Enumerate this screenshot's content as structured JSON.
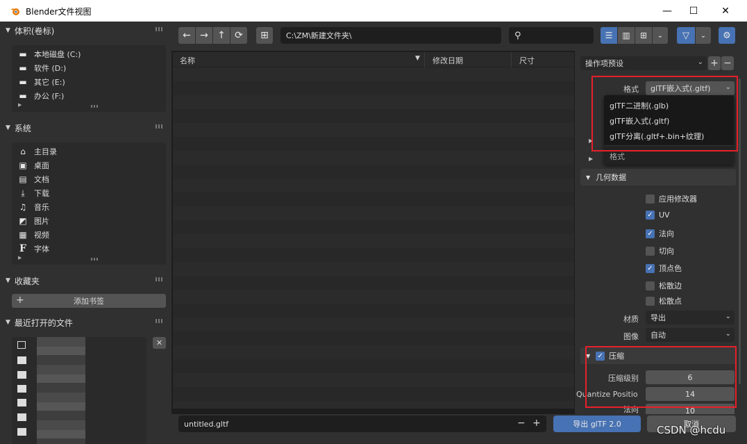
{
  "window": {
    "title": "Blender文件视图"
  },
  "sidebar": {
    "volumes": {
      "title": "体积(卷标)",
      "items": [
        {
          "label": "本地磁盘 (C:)",
          "icon": "disk-icon"
        },
        {
          "label": "软件 (D:)",
          "icon": "disk-icon"
        },
        {
          "label": "其它 (E:)",
          "icon": "disk-icon"
        },
        {
          "label": "办公 (F:)",
          "icon": "disk-icon"
        }
      ]
    },
    "system": {
      "title": "系统",
      "items": [
        {
          "label": "主目录",
          "icon": "home-icon"
        },
        {
          "label": "桌面",
          "icon": "desktop-icon"
        },
        {
          "label": "文档",
          "icon": "document-icon"
        },
        {
          "label": "下载",
          "icon": "download-icon"
        },
        {
          "label": "音乐",
          "icon": "music-icon"
        },
        {
          "label": "图片",
          "icon": "image-icon"
        },
        {
          "label": "视频",
          "icon": "film-icon"
        },
        {
          "label": "字体",
          "icon": "font-icon"
        }
      ]
    },
    "bookmarks": {
      "title": "收藏夹",
      "add_label": "添加书签"
    },
    "recent": {
      "title": "最近打开的文件"
    }
  },
  "topbar": {
    "path": "C:\\ZM\\新建文件夹\\",
    "search_value": ""
  },
  "list": {
    "col_name": "名称",
    "col_date": "修改日期",
    "col_size": "尺寸"
  },
  "right": {
    "preset_label": "操作项预设",
    "format_label": "格式",
    "format_value": "glTF嵌入式(.gltf)",
    "format_options": [
      "glTF二进制(.glb)",
      "glTF嵌入式(.gltf)",
      "glTF分离(.gltf+.bin+纹理)"
    ],
    "format_tooltip": "格式",
    "geometry_title": "几何数据",
    "checks": [
      {
        "label": "应用修改器",
        "on": false
      },
      {
        "label": "UV",
        "on": true
      },
      {
        "label": "法向",
        "on": true
      },
      {
        "label": "切向",
        "on": false
      },
      {
        "label": "顶点色",
        "on": true
      },
      {
        "label": "松散边",
        "on": false
      },
      {
        "label": "松散点",
        "on": false
      }
    ],
    "material_label": "材质",
    "material_value": "导出",
    "image_label": "图像",
    "image_value": "自动",
    "compression_title": "压缩",
    "compress_level_label": "压缩级别",
    "compress_level_value": "6",
    "quantize_label": "Quantize Positio",
    "quantize_value": "14",
    "normal_label": "法向",
    "normal_value": "10"
  },
  "bottom": {
    "filename": "untitled.gltf",
    "minus": "−",
    "plus": "+",
    "export_label": "导出 glTF 2.0",
    "cancel_label": "取消"
  },
  "watermark": "CSDN @hcdu"
}
